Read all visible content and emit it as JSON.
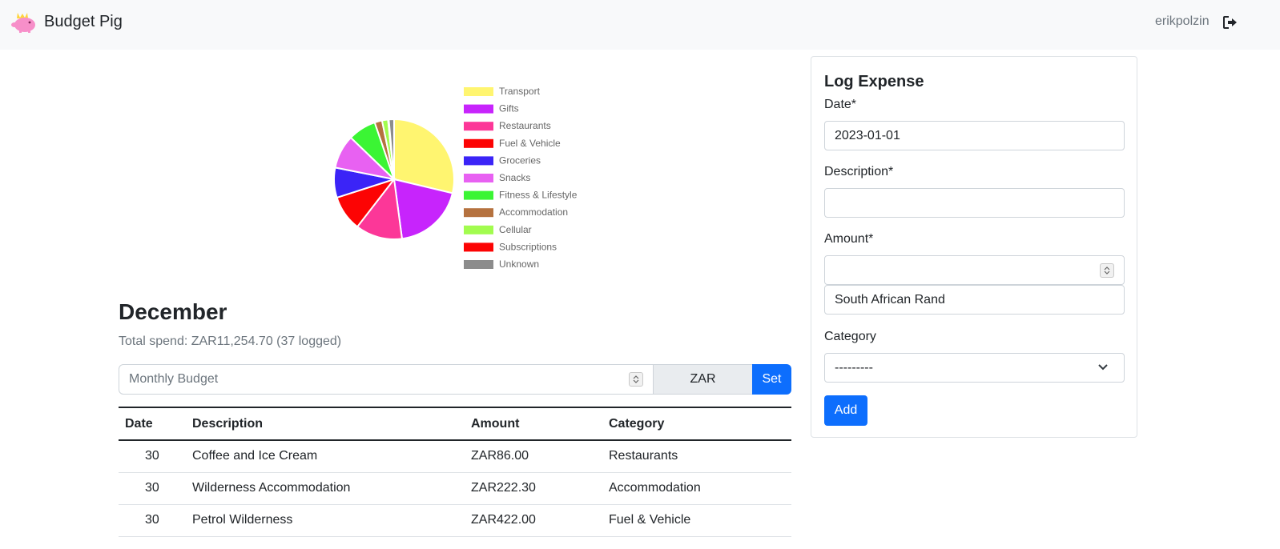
{
  "navbar": {
    "brand": "Budget Pig",
    "username": "erikpolzin",
    "logo_icon": "pig-icon",
    "logout_icon": "sign-out-icon"
  },
  "chart_data": {
    "type": "pie",
    "legend_position": "right",
    "categories": [
      "Transport",
      "Gifts",
      "Restaurants",
      "Fuel & Vehicle",
      "Groceries",
      "Snacks",
      "Fitness & Lifestyle",
      "Accommodation",
      "Cellular",
      "Subscriptions",
      "Unknown"
    ],
    "values": [
      28.5,
      19.0,
      12.5,
      9.5,
      8.0,
      9.0,
      7.5,
      2.0,
      1.6,
      0.2,
      1.4
    ],
    "colors": [
      "#fff570",
      "#c724fc",
      "#fc3798",
      "#fc0404",
      "#3b24f7",
      "#e861f2",
      "#3bf534",
      "#b5723f",
      "#a2fc4f",
      "#fc0404",
      "#8c8c8c"
    ]
  },
  "month": {
    "title": "December",
    "total_spend": "Total spend: ZAR11,254.70 (37 logged)"
  },
  "budget": {
    "placeholder": "Monthly Budget",
    "currency": "ZAR",
    "set_label": "Set"
  },
  "table": {
    "headers": {
      "date": "Date",
      "description": "Description",
      "amount": "Amount",
      "category": "Category"
    },
    "rows": [
      {
        "date": "30",
        "description": "Coffee and Ice Cream",
        "amount": "ZAR86.00",
        "category": "Restaurants"
      },
      {
        "date": "30",
        "description": "Wilderness Accommodation",
        "amount": "ZAR222.30",
        "category": "Accommodation"
      },
      {
        "date": "30",
        "description": "Petrol Wilderness",
        "amount": "ZAR422.00",
        "category": "Fuel & Vehicle"
      }
    ]
  },
  "log_expense": {
    "title": "Log Expense",
    "date_label": "Date*",
    "date_value": "2023-01-01",
    "description_label": "Description*",
    "description_value": "",
    "amount_label": "Amount*",
    "amount_value": "",
    "currency_value": "South African Rand",
    "category_label": "Category",
    "category_value": "---------",
    "add_label": "Add"
  }
}
